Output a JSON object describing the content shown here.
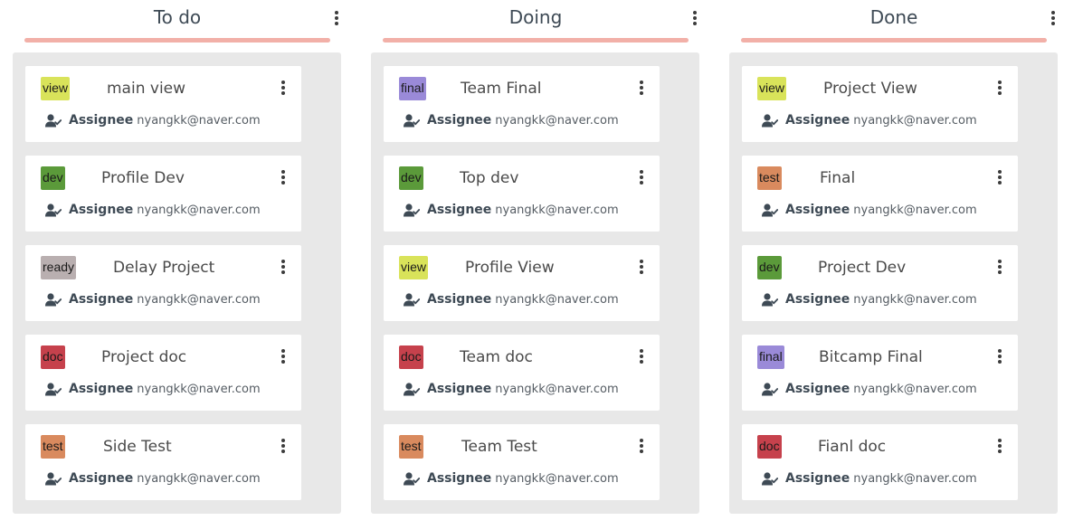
{
  "board": {
    "assignee_label": "Assignee",
    "colors": {
      "column_bg": "#e8e8e8",
      "underline": "#f2b0a8",
      "tags": {
        "view": "#d9e35a",
        "dev": "#5b9a3a",
        "ready": "#b9afb0",
        "doc": "#c6414c",
        "test": "#d98a5e",
        "final": "#9a8ad8"
      }
    },
    "columns": [
      {
        "title": "To do",
        "cards": [
          {
            "tag": "view",
            "title": "main view",
            "email": "nyangkk@naver.com"
          },
          {
            "tag": "dev",
            "title": "Profile Dev",
            "email": "nyangkk@naver.com"
          },
          {
            "tag": "ready",
            "title": "Delay Project",
            "email": "nyangkk@naver.com"
          },
          {
            "tag": "doc",
            "title": "Project doc",
            "email": "nyangkk@naver.com"
          },
          {
            "tag": "test",
            "title": "Side Test",
            "email": "nyangkk@naver.com"
          }
        ]
      },
      {
        "title": "Doing",
        "cards": [
          {
            "tag": "final",
            "title": "Team Final",
            "email": "nyangkk@naver.com"
          },
          {
            "tag": "dev",
            "title": "Top dev",
            "email": "nyangkk@naver.com"
          },
          {
            "tag": "view",
            "title": "Profile View",
            "email": "nyangkk@naver.com"
          },
          {
            "tag": "doc",
            "title": "Team doc",
            "email": "nyangkk@naver.com"
          },
          {
            "tag": "test",
            "title": "Team Test",
            "email": "nyangkk@naver.com"
          }
        ]
      },
      {
        "title": "Done",
        "cards": [
          {
            "tag": "view",
            "title": "Project View",
            "email": "nyangkk@naver.com"
          },
          {
            "tag": "test",
            "title": "Final",
            "email": "nyangkk@naver.com"
          },
          {
            "tag": "dev",
            "title": "Project Dev",
            "email": "nyangkk@naver.com"
          },
          {
            "tag": "final",
            "title": "Bitcamp Final",
            "email": "nyangkk@naver.com"
          },
          {
            "tag": "doc",
            "title": "Fianl doc",
            "email": "nyangkk@naver.com"
          }
        ]
      }
    ]
  }
}
